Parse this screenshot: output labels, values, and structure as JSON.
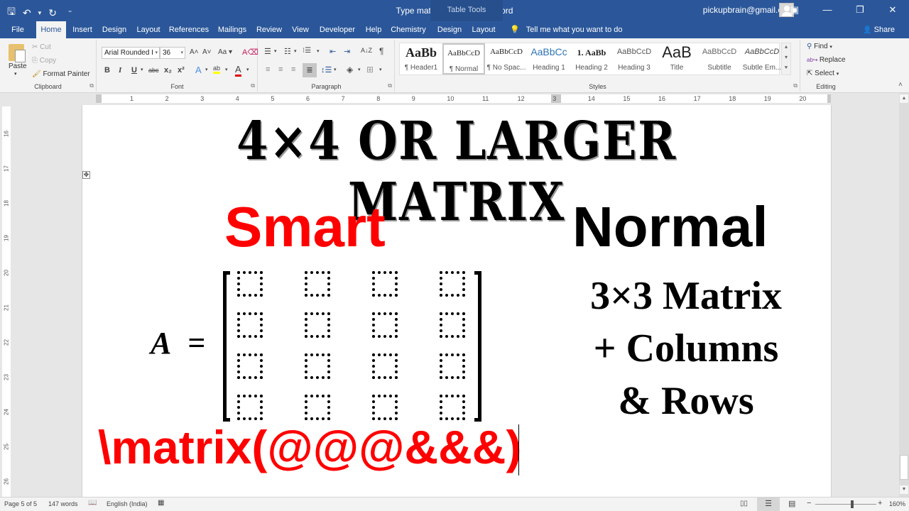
{
  "window": {
    "title": "Type matrix in Ms Word  -  Word",
    "contextual_group": "Table Tools",
    "account": "pickupbrain@gmail.com",
    "controls": {
      "ribbon_display": "▣",
      "minimize": "—",
      "restore": "❐",
      "close": "✕"
    }
  },
  "qat": {
    "save": "🖫",
    "undo": "↶",
    "undo_dd": "▾",
    "redo": "↻",
    "customize": "⁼"
  },
  "tabs": [
    {
      "label": "File"
    },
    {
      "label": "Home",
      "active": true
    },
    {
      "label": "Insert"
    },
    {
      "label": "Design"
    },
    {
      "label": "Layout"
    },
    {
      "label": "References"
    },
    {
      "label": "Mailings"
    },
    {
      "label": "Review"
    },
    {
      "label": "View"
    },
    {
      "label": "Developer"
    },
    {
      "label": "Help"
    },
    {
      "label": "Chemistry"
    },
    {
      "label": "Design"
    },
    {
      "label": "Layout"
    }
  ],
  "tell_me": {
    "icon": "💡",
    "placeholder": "Tell me what you want to do"
  },
  "share": {
    "icon": "👤",
    "label": "Share"
  },
  "ribbon": {
    "clipboard": {
      "label": "Clipboard",
      "paste": "Paste",
      "paste_dd": "▾",
      "cut": "Cut",
      "copy": "Copy",
      "format_painter": "Format Painter"
    },
    "font": {
      "label": "Font",
      "font_name": "Arial Rounded I",
      "font_size": "36",
      "grow": "A˄",
      "shrink": "A˅",
      "change_case": "Aa ▾",
      "clear": "A⌫",
      "bold": "B",
      "italic": "I",
      "underline": "U",
      "underline_dd": "▾",
      "strike": "abc",
      "subscript": "x₂",
      "superscript": "x²",
      "text_effects": "A",
      "highlight": "ab",
      "font_color": "A",
      "dd": "▾",
      "highlight_color": "#ffff00",
      "font_color_value": "#ff0000"
    },
    "paragraph": {
      "label": "Paragraph",
      "bullets": "☰",
      "numbering": "☷",
      "multilevel": "⁝☰",
      "dec_indent": "⇤",
      "inc_indent": "⇥",
      "sort": "A↓Z",
      "show_marks": "¶",
      "align_left": "≡",
      "center": "≡",
      "align_right": "≡",
      "justify": "≣",
      "line_spacing": "↕☰",
      "shading": "◈",
      "borders": "⊞",
      "dd": "▾"
    },
    "styles": {
      "label": "Styles",
      "items": [
        {
          "preview": "AaBb",
          "name": "¶ Header1"
        },
        {
          "preview": "AaBbCcD",
          "name": "¶ Normal",
          "selected": true
        },
        {
          "preview": "AaBbCcD",
          "name": "¶ No Spac..."
        },
        {
          "preview": "AaBbCc",
          "name": "Heading 1"
        },
        {
          "preview": "1. AaBb",
          "name": "Heading 2"
        },
        {
          "preview": "AaBbCcD",
          "name": "Heading 3"
        },
        {
          "preview": "AaB",
          "name": "Title"
        },
        {
          "preview": "AaBbCcD",
          "name": "Subtitle"
        },
        {
          "preview": "AaBbCcD",
          "name": "Subtle Em..."
        }
      ],
      "scroll_up": "▴",
      "scroll_down": "▾",
      "more": "⯆"
    },
    "editing": {
      "label": "Editing",
      "find": "Find",
      "find_dd": "▾",
      "replace": "Replace",
      "select": "Select",
      "select_dd": "▾",
      "collapse": "˄"
    }
  },
  "ruler": {
    "tab_selector": "L",
    "h_numbers": [
      "1",
      "2",
      "3",
      "4",
      "5",
      "6",
      "7",
      "8",
      "9",
      "10",
      "11",
      "12",
      "3",
      "14",
      "15",
      "16",
      "17",
      "18",
      "19",
      "20"
    ],
    "v_numbers": [
      "16",
      "17",
      "18",
      "19",
      "20",
      "21",
      "22",
      "23",
      "24",
      "25",
      "26"
    ]
  },
  "document": {
    "heading": "4×4 OR LARGER MATRIX",
    "smart_label": "Smart",
    "normal_label": "Normal",
    "equation_lhs_var": "A",
    "equation_eq": "=",
    "matrix_rows": 4,
    "matrix_cols": 4,
    "normal_desc": [
      "3×3 Matrix",
      "+ Columns",
      "& Rows"
    ],
    "matrix_command": "\\matrix(@@@&&&)",
    "colors": {
      "smart": "#ff0000",
      "command": "#ff0000",
      "text": "#000000"
    },
    "table_move_handle": "✥"
  },
  "statusbar": {
    "page": "Page 5 of 5",
    "words": "147 words",
    "proofing_icon": "📖",
    "language": "English (India)",
    "macro_icon": "▦",
    "read_mode": "▯▯",
    "print_layout": "☰",
    "web_layout": "▤",
    "zoom_out": "−",
    "zoom_in": "+",
    "zoom_level": "160%",
    "zoom_fraction": 0.6
  }
}
